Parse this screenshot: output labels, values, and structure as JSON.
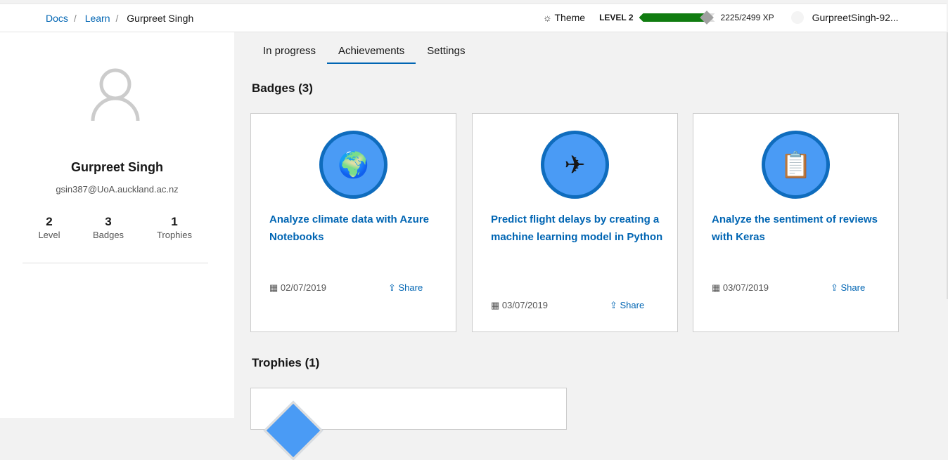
{
  "breadcrumb": [
    "Docs",
    "Learn",
    "Gurpreet Singh"
  ],
  "header": {
    "theme_label": "Theme",
    "level_label": "LEVEL 2",
    "xp": "2225/2499 XP",
    "xp_progress": 0.89,
    "username": "GurpreetSingh-92..."
  },
  "profile": {
    "name": "Gurpreet Singh",
    "email": "gsin387@UoA.auckland.ac.nz",
    "stats": [
      {
        "value": "2",
        "label": "Level"
      },
      {
        "value": "3",
        "label": "Badges"
      },
      {
        "value": "1",
        "label": "Trophies"
      }
    ]
  },
  "tabs": [
    "In progress",
    "Achievements",
    "Settings"
  ],
  "active_tab": "Achievements",
  "badges_heading": "Badges (3)",
  "badges": [
    {
      "title": "Analyze climate data with Azure Notebooks",
      "date": "02/07/2019",
      "share": "Share",
      "icon": "globe-icon"
    },
    {
      "title": "Predict flight delays by creating a machine learning model in Python",
      "date": "03/07/2019",
      "share": "Share",
      "icon": "airplane-icon"
    },
    {
      "title": "Analyze the sentiment of reviews with Keras",
      "date": "03/07/2019",
      "share": "Share",
      "icon": "clipboard-thumbs-up-icon"
    }
  ],
  "trophies_heading": "Trophies (1)",
  "accent": "#0065b3"
}
